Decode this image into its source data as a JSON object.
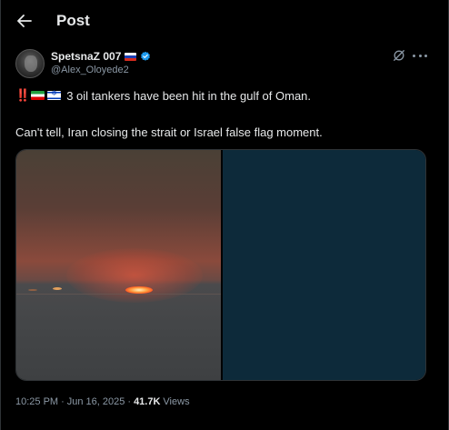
{
  "header": {
    "title": "Post"
  },
  "author": {
    "display_name": "SpetsnaZ 007",
    "handle": "@Alex_Oloyede2"
  },
  "post": {
    "prefix": "‼️",
    "line1": "3 oil tankers have been hit in the gulf of Oman.",
    "line2": "Can't tell, Iran closing the strait or Israel false flag moment."
  },
  "meta": {
    "time": "10:25 PM",
    "separator1": "·",
    "date": "Jun 16, 2025",
    "separator2": "·",
    "views_count": "41.7K",
    "views_label": "Views"
  },
  "icons": {
    "back": "arrow-left-icon",
    "verified": "verified-badge-icon",
    "grok": "grok-icon",
    "more": "more-icon"
  },
  "colors": {
    "background": "#000000",
    "text_primary": "#e7e9ea",
    "text_secondary": "#8b98a5",
    "verified_blue": "#1d9bf0",
    "media_right": "#0d2a3a"
  }
}
